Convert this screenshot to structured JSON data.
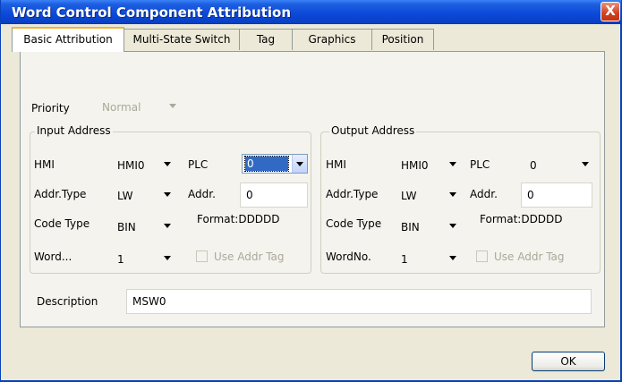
{
  "window": {
    "title": "Word Control Component Attribution",
    "close_glyph": "X"
  },
  "tabs": [
    {
      "label": "Basic Attribution",
      "active": true
    },
    {
      "label": "Multi-State Switch",
      "active": false
    },
    {
      "label": "Tag",
      "active": false
    },
    {
      "label": "Graphics",
      "active": false
    },
    {
      "label": "Position",
      "active": false
    }
  ],
  "priority": {
    "label": "Priority",
    "value": "Normal",
    "disabled": true
  },
  "input_address": {
    "title": "Input Address",
    "hmi_label": "HMI",
    "hmi_value": "HMI0",
    "plc_label": "PLC",
    "plc_value": "0",
    "addr_type_label": "Addr.Type",
    "addr_type_value": "LW",
    "addr_label": "Addr.",
    "addr_value": "0",
    "code_type_label": "Code Type",
    "code_type_value": "BIN",
    "format_text": "Format:DDDDD",
    "word_label": "Word...",
    "word_value": "1",
    "use_addr_tag_label": "Use Addr Tag"
  },
  "output_address": {
    "title": "Output Address",
    "hmi_label": "HMI",
    "hmi_value": "HMI0",
    "plc_label": "PLC",
    "plc_value": "0",
    "addr_type_label": "Addr.Type",
    "addr_type_value": "LW",
    "addr_label": "Addr.",
    "addr_value": "0",
    "code_type_label": "Code Type",
    "code_type_value": "BIN",
    "format_text": "Format:DDDDD",
    "word_label": "WordNo.",
    "word_value": "1",
    "use_addr_tag_label": "Use Addr Tag"
  },
  "description": {
    "label": "Description",
    "value": "MSW0"
  },
  "buttons": {
    "ok_label": "OK"
  },
  "colors": {
    "title_bar": "#0b49d8",
    "active_tab_accent": "#f0b23c",
    "selection": "#316ac5"
  }
}
